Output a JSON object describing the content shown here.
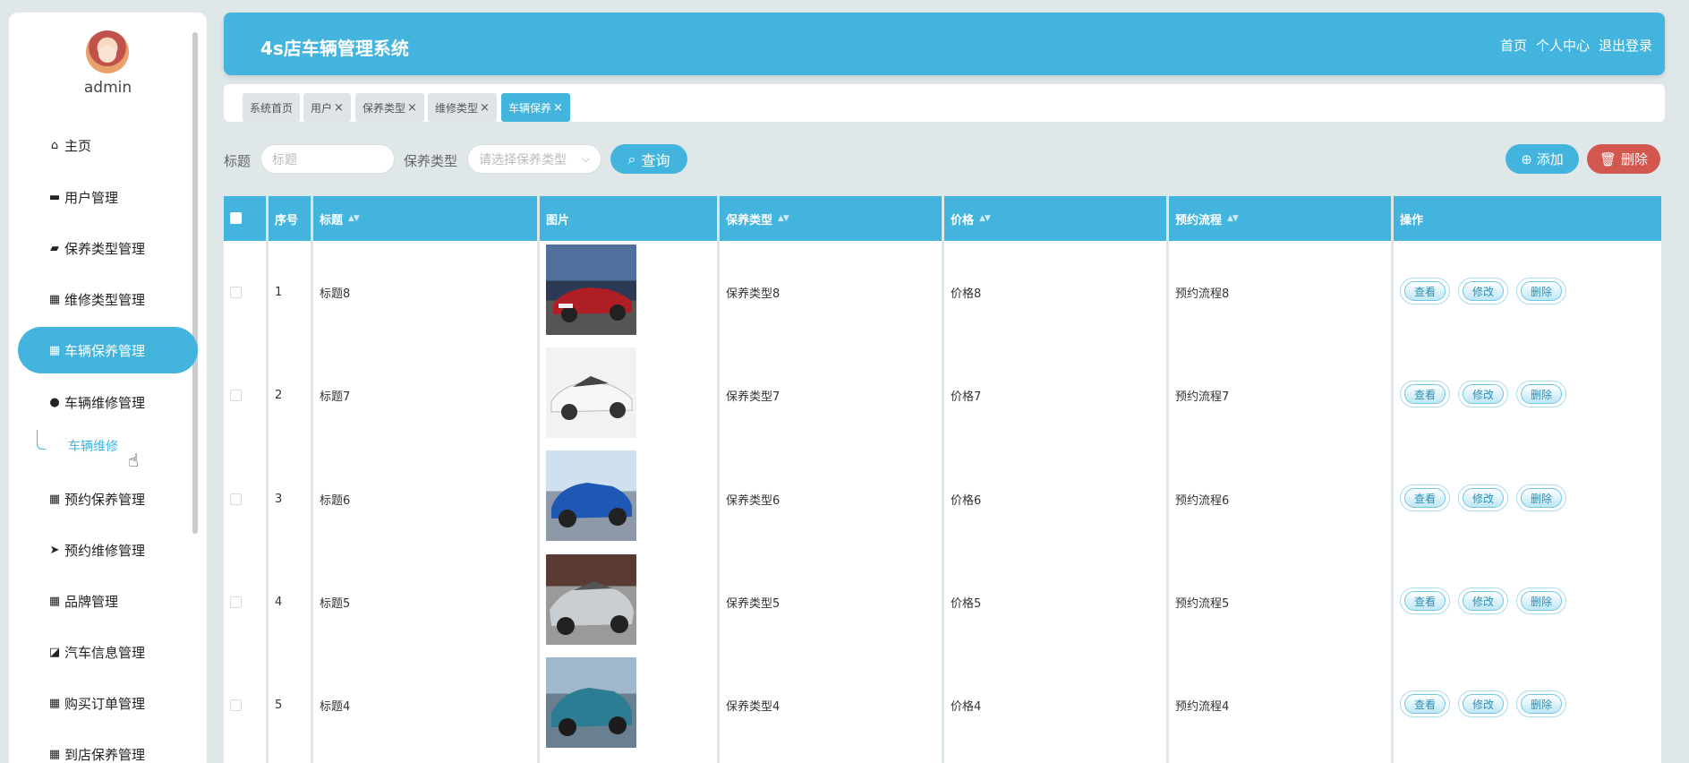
{
  "sidebar": {
    "username": "admin",
    "menu": [
      {
        "label": "主页",
        "icon": "home-icon"
      },
      {
        "label": "用户管理",
        "icon": "ticket-icon"
      },
      {
        "label": "保养类型管理",
        "icon": "briefcase-icon"
      },
      {
        "label": "维修类型管理",
        "icon": "grid-icon"
      },
      {
        "label": "车辆保养管理",
        "icon": "grid-icon"
      },
      {
        "label": "车辆维修管理",
        "icon": "user-icon"
      },
      {
        "label": "预约保养管理",
        "icon": "grid-icon"
      },
      {
        "label": "预约维修管理",
        "icon": "send-icon"
      },
      {
        "label": "品牌管理",
        "icon": "grid-icon"
      },
      {
        "label": "汽车信息管理",
        "icon": "chart-icon"
      },
      {
        "label": "购买订单管理",
        "icon": "grid-icon"
      },
      {
        "label": "到店保养管理",
        "icon": "grid-icon"
      }
    ],
    "submenu_label": "车辆维修"
  },
  "header": {
    "title": "4s店车辆管理系统",
    "links": [
      "首页",
      "个人中心",
      "退出登录"
    ]
  },
  "tabs": [
    {
      "label": "系统首页",
      "closable": false,
      "active": false
    },
    {
      "label": "用户",
      "closable": true,
      "active": false
    },
    {
      "label": "保养类型",
      "closable": true,
      "active": false
    },
    {
      "label": "维修类型",
      "closable": true,
      "active": false
    },
    {
      "label": "车辆保养",
      "closable": true,
      "active": true
    }
  ],
  "search": {
    "title_label": "标题",
    "title_placeholder": "标题",
    "type_label": "保养类型",
    "type_placeholder": "请选择保养类型",
    "query_button": "查询",
    "add_button": "添加",
    "delete_button": "删除"
  },
  "table": {
    "columns": [
      "序号",
      "标题",
      "图片",
      "保养类型",
      "价格",
      "预约流程",
      "操作"
    ],
    "rows": [
      {
        "index": "1",
        "title": "标题8",
        "type": "保养类型8",
        "price": "价格8",
        "flow": "预约流程8",
        "car": "red"
      },
      {
        "index": "2",
        "title": "标题7",
        "type": "保养类型7",
        "price": "价格7",
        "flow": "预约流程7",
        "car": "white"
      },
      {
        "index": "3",
        "title": "标题6",
        "type": "保养类型6",
        "price": "价格6",
        "flow": "预约流程6",
        "car": "blue"
      },
      {
        "index": "4",
        "title": "标题5",
        "type": "保养类型5",
        "price": "价格5",
        "flow": "预约流程5",
        "car": "silver"
      },
      {
        "index": "5",
        "title": "标题4",
        "type": "保养类型4",
        "price": "价格4",
        "flow": "预约流程4",
        "car": "teal"
      }
    ],
    "actions": [
      "查看",
      "修改",
      "删除"
    ]
  },
  "colors": {
    "accent": "#42b4de",
    "danger": "#d2574e",
    "background": "#dfe7e8"
  }
}
